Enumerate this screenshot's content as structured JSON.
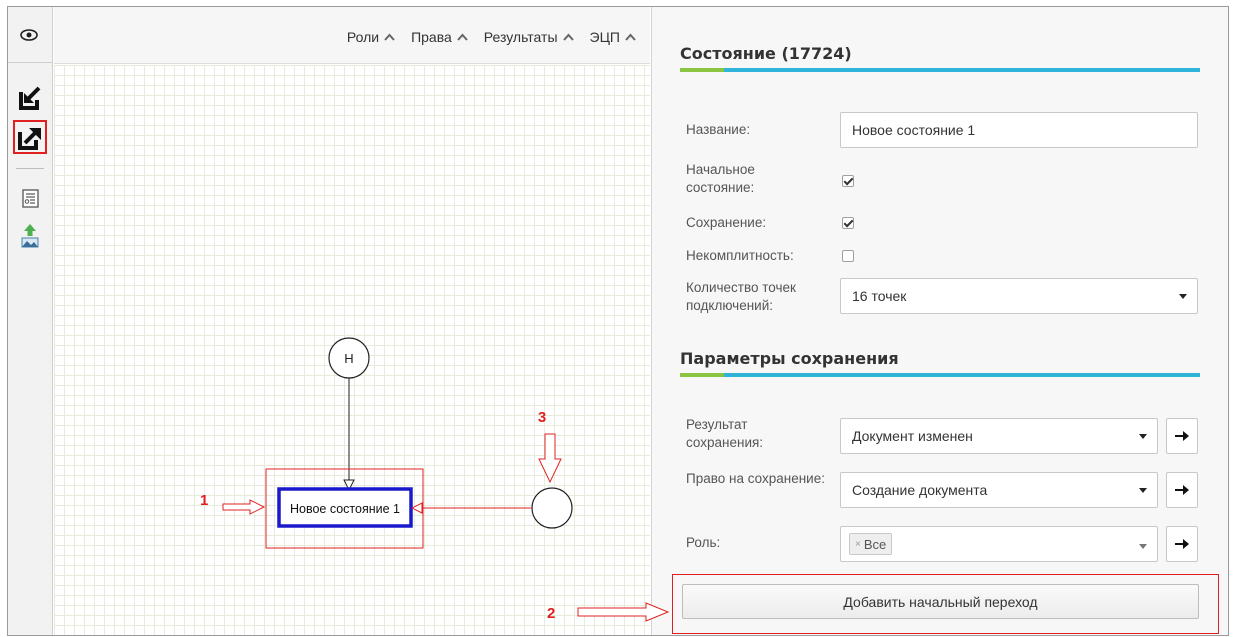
{
  "canvas_header": {
    "menu": [
      {
        "label": "Роли"
      },
      {
        "label": "Права"
      },
      {
        "label": "Результаты"
      },
      {
        "label": "ЭЦП"
      }
    ]
  },
  "diagram": {
    "start_node_label": "Н",
    "state_node_label": "Новое состояние 1",
    "annotations": {
      "a1": "1",
      "a2": "2",
      "a3": "3"
    }
  },
  "panel": {
    "state_title": "Состояние (17724)",
    "fields": {
      "name_label": "Название:",
      "name_value": "Новое состояние 1",
      "initial_label": "Начальное состояние:",
      "initial_checked": true,
      "save_label": "Сохранение:",
      "save_checked": true,
      "incomplete_label": "Некомплитность:",
      "incomplete_checked": false,
      "points_label": "Количество точек подключений:",
      "points_value": "16 точек"
    },
    "save_params_title": "Параметры сохранения",
    "save_params": {
      "result_label": "Результат сохранения:",
      "result_value": "Документ изменен",
      "right_label": "Право на сохранение:",
      "right_value": "Создание документа",
      "role_label": "Роль:",
      "role_tag": "Все",
      "role_tag_remove": "×"
    },
    "add_button_label": "Добавить начальный переход"
  },
  "colors": {
    "accent_blue": "#2fb3d9",
    "accent_green": "#8bc441",
    "annotation_red": "#e02020",
    "selected_node_border": "#1a1acc"
  }
}
